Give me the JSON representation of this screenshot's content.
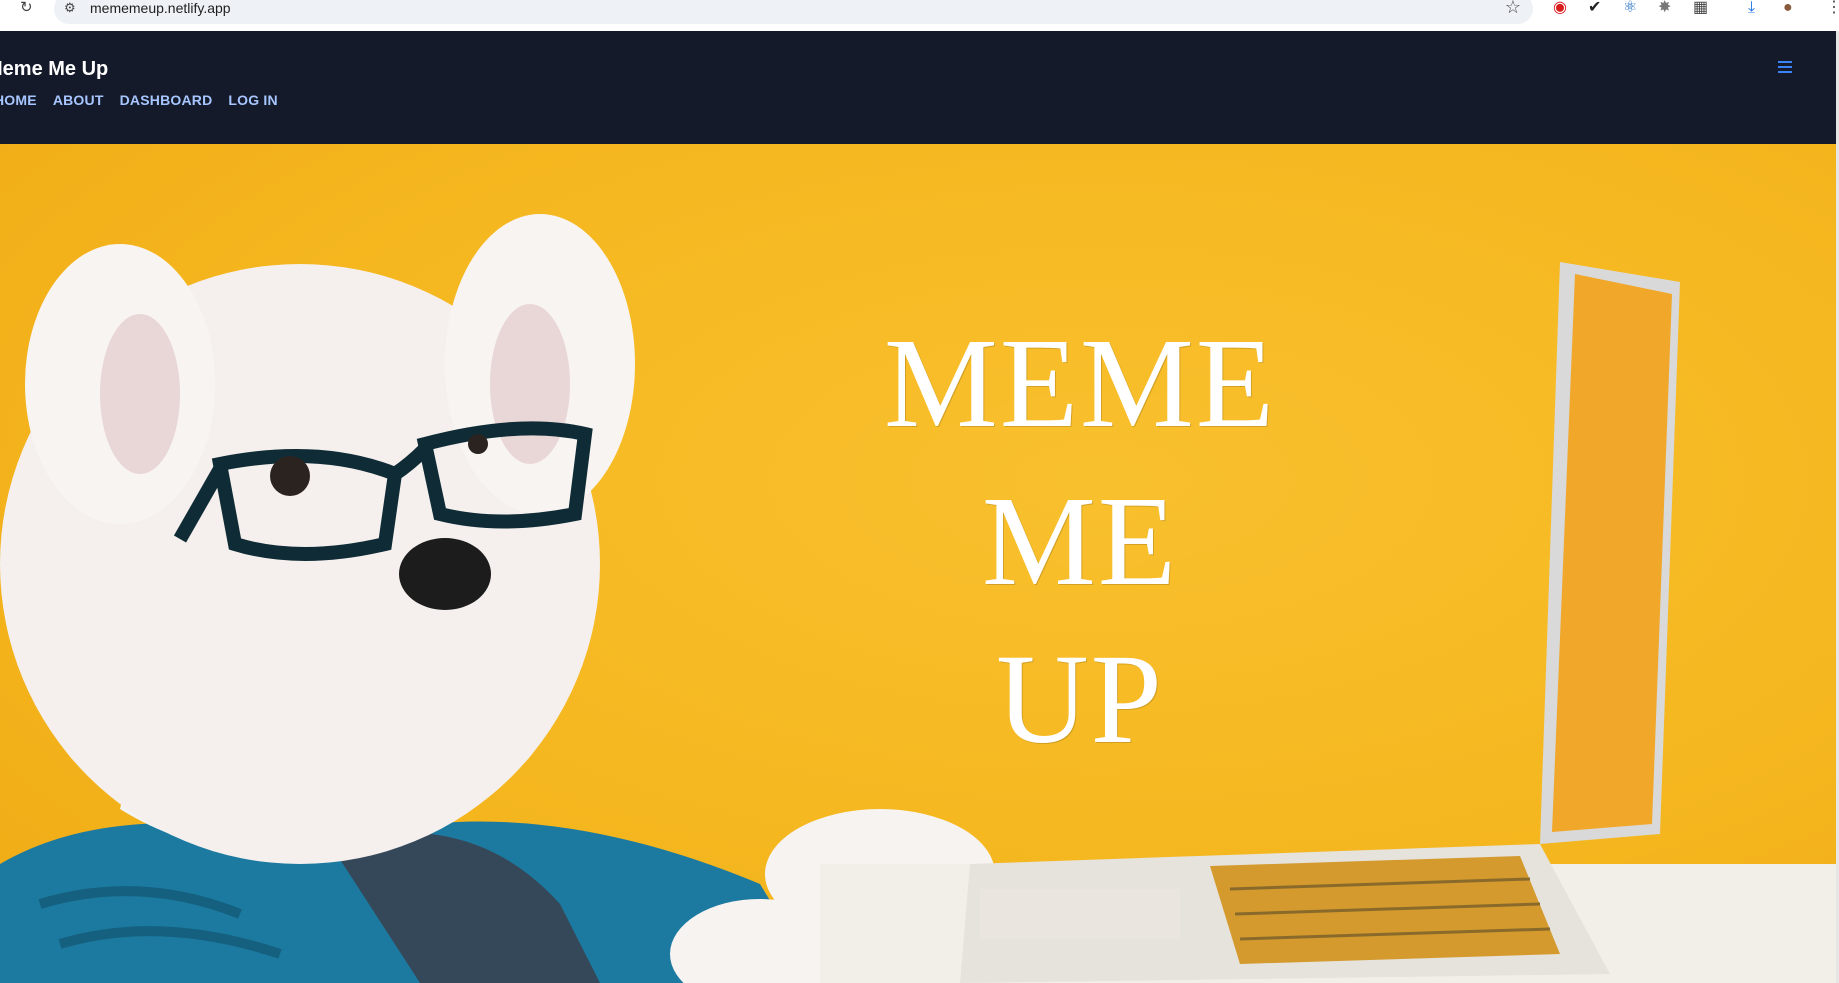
{
  "browser": {
    "url": "mememeup.netlify.app"
  },
  "navbar": {
    "brand": "Meme Me Up",
    "links": [
      {
        "label": "HOME"
      },
      {
        "label": "ABOUT"
      },
      {
        "label": "DASHBOARD"
      },
      {
        "label": "LOG IN"
      }
    ]
  },
  "hero": {
    "title_lines": [
      "MEME",
      "ME",
      "UP"
    ]
  },
  "colors": {
    "navbar_bg": "#141a29",
    "nav_link": "#a7c6ff",
    "hero_bg": "#f5b71f",
    "hamburger": "#3b82f6"
  }
}
